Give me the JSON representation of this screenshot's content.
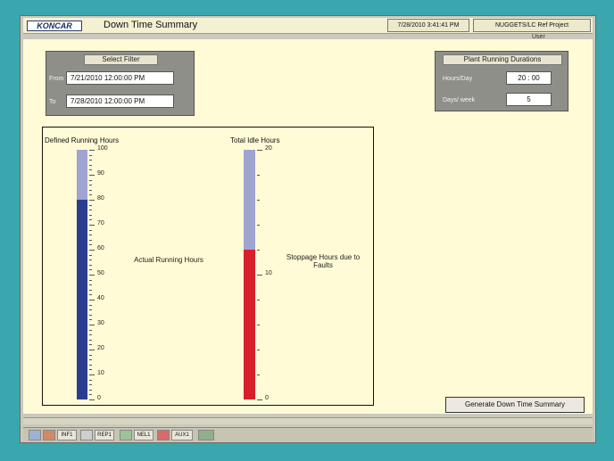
{
  "header": {
    "logo_text": "KONCAR",
    "title": "Down Time Summary",
    "datetime": "7/28/2010 3:41:41 PM",
    "project": "NUGGETS/LC Ref Project",
    "user_label": "User"
  },
  "filter": {
    "title": "Select Filter",
    "from_label": "From",
    "from_value": "7/21/2010 12:00:00 PM",
    "to_label": "To",
    "to_value": "7/28/2010 12:00:00 PM"
  },
  "plant": {
    "title": "Plant Running Durations",
    "hours_label": "Hours/Day",
    "hours_value": "20 : 00",
    "days_label": "Days/ week",
    "days_value": "5"
  },
  "running_bar": {
    "title": "Defined Running Hours",
    "inner_label": "Actual Running Hours",
    "scale_max": 100,
    "value": 80,
    "ticks": [
      "100",
      "90",
      "80",
      "70",
      "60",
      "50",
      "40",
      "30",
      "20",
      "10",
      "0"
    ],
    "defined_color": "#a0a4d0",
    "actual_color": "#2b3d8f"
  },
  "idle_bar": {
    "title": "Total Idle Hours",
    "inner_label": "Stoppage Hours due to Faults",
    "scale_max": 20,
    "value": 12,
    "ticks": [
      "20",
      "10",
      "0"
    ],
    "idle_color": "#a0a4d0",
    "fault_color": "#d7202a"
  },
  "actions": {
    "generate_button": "Generate Down Time Summary"
  },
  "taskbar": {
    "items": [
      "",
      "",
      "INF1",
      "",
      "REP1",
      "",
      "NEL1",
      "",
      "AUX1",
      ""
    ]
  }
}
